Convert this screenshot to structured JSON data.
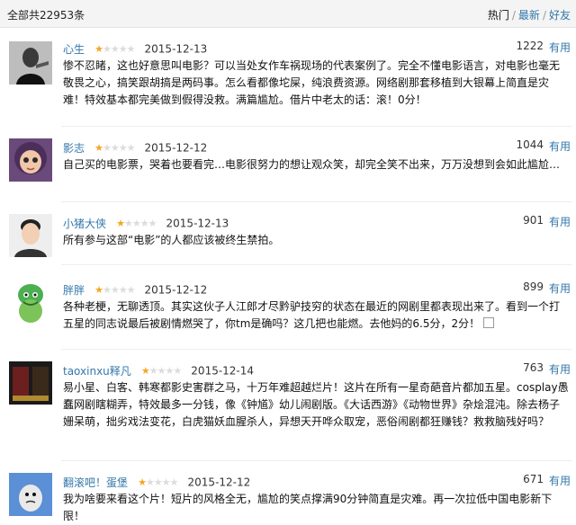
{
  "header": {
    "total": "全部共22953条",
    "sort": {
      "hot": "热门",
      "sep1": "/",
      "latest": "最新",
      "sep2": "/",
      "friends": "好友"
    }
  },
  "useful_label": "有用",
  "colors": {
    "link": "#3377aa",
    "star_on": "#f5a623",
    "star_off": "#dcdcdc"
  },
  "comments": [
    {
      "user": "心生",
      "rating": 1,
      "date": "2015-12-13",
      "votes": "1222",
      "avatar_icon": "man-photo-avatar",
      "text": "惨不忍睹，这也好意思叫电影？可以当处女作车祸现场的代表案例了。完全不懂电影语言，对电影也毫无敬畏之心，搞笑跟胡搞是两码事。怎么看都像坨屎，纯浪费资源。网络剧那套移植到大银幕上简直是灾难！特效基本都完美做到假得没救。满篇尴尬。借片中老太的话：滚！0分！"
    },
    {
      "user": "影志",
      "rating": 1,
      "date": "2015-12-12",
      "votes": "1044",
      "avatar_icon": "cartoon-girl-avatar",
      "text": "自己买的电影票，哭着也要看完…电影很努力的想让观众笑，却完全笑不出来，万万没想到会如此尴尬…"
    },
    {
      "user": "小猪大侠",
      "rating": 1,
      "date": "2015-12-13",
      "votes": "901",
      "avatar_icon": "young-man-avatar",
      "text": "所有参与这部“电影”的人都应该被终生禁拍。"
    },
    {
      "user": "胖胖",
      "rating": 1,
      "date": "2015-12-12",
      "votes": "899",
      "avatar_icon": "green-monster-avatar",
      "text": "各种老梗，无聊透顶。其实这伙子人江郎才尽黔驴技穷的状态在最近的网剧里都表现出来了。看到一个打五星的同志说最后被剧情燃哭了，你tm是确吗？这几把也能燃。去他妈的6.5分，2分！"
    },
    {
      "user": "taoxinxu释凡",
      "rating": 1,
      "date": "2015-12-14",
      "votes": "763",
      "avatar_icon": "movie-poster-avatar",
      "text": "易小星、白客、韩寒都影史害群之马，十万年难超越烂片！这片在所有一星奇葩音片都加五星。cosplay愚蠢网剧瞎糊弄，特效最多一分钱，像《钟馗》幼儿闹剧版。《大话西游》《动物世界》杂烩混沌。除去杨子姗呆萌，拙劣戏法变花，白虎猫妖血腥杀人，异想天开哗众取宠，恶俗闹剧都狂赚钱？救救脑残好吗？"
    },
    {
      "user": "翻滚吧！蛋堡",
      "rating": 1,
      "date": "2015-12-12",
      "votes": "671",
      "avatar_icon": "cartoon-egg-avatar",
      "text": "我为啥要来看这个片！短片的风格全无，尴尬的笑点撑满90分钟简直是灾难。再一次拉低中国电影新下限！"
    }
  ]
}
